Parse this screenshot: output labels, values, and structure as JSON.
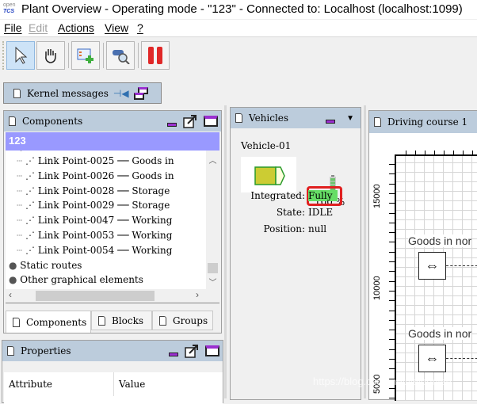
{
  "window": {
    "logo_top": "open",
    "logo_bottom": "TCS",
    "title": "Plant Overview - Operating mode - \"123\" - Connected to: Localhost (localhost:1099)"
  },
  "menu": [
    {
      "label": "File",
      "enabled": true
    },
    {
      "label": "Edit",
      "enabled": false
    },
    {
      "label": "Actions",
      "enabled": true
    },
    {
      "label": "View",
      "enabled": true
    },
    {
      "label": "?",
      "enabled": true
    }
  ],
  "toolbar": [
    {
      "icon": "select-pointer-icon",
      "selected": true
    },
    {
      "icon": "hand-pan-icon",
      "selected": false
    },
    {
      "icon": "create-order-icon",
      "selected": false
    },
    {
      "icon": "find-vehicle-icon",
      "selected": false
    },
    {
      "icon": "pause-vehicles-icon",
      "selected": false
    }
  ],
  "kernel_messages": {
    "label": "Kernel messages"
  },
  "components": {
    "title": "Components",
    "selected_model": "123",
    "items": [
      {
        "type": "link",
        "label": "Link Point-0025 ── Goods in"
      },
      {
        "type": "link",
        "label": "Link Point-0026 ── Goods in"
      },
      {
        "type": "link",
        "label": "Link Point-0028 ── Storage"
      },
      {
        "type": "link",
        "label": "Link Point-0029 ── Storage"
      },
      {
        "type": "link",
        "label": "Link Point-0047 ── Working"
      },
      {
        "type": "link",
        "label": "Link Point-0053 ── Working"
      },
      {
        "type": "link",
        "label": "Link Point-0054 ── Working"
      },
      {
        "type": "folder",
        "label": "Static routes"
      },
      {
        "type": "folder",
        "label": "Other graphical elements"
      }
    ],
    "tabs": [
      {
        "label": "Components",
        "active": true
      },
      {
        "label": "Blocks",
        "active": false
      },
      {
        "label": "Groups",
        "active": false
      }
    ]
  },
  "properties": {
    "title": "Properties",
    "columns": [
      "Attribute",
      "Value"
    ]
  },
  "vehicles": {
    "title": "Vehicles",
    "vehicle": {
      "name": "Vehicle-01",
      "battery": "100 %",
      "battery_level": 1.0,
      "integrated_label": "Integrated:",
      "integrated": "Fully",
      "state_label": "State:",
      "state": "IDLE",
      "position_label": "Position:",
      "position": "null",
      "color": "#cccc33",
      "highlight": "#66dd66"
    }
  },
  "driving_course": {
    "title": "Driving course 1",
    "y_ticks": [
      "15000",
      "10000",
      "5000"
    ],
    "station_label": "Goods in nor"
  },
  "watermark": "https://blog.csdn.net/jielounlee"
}
